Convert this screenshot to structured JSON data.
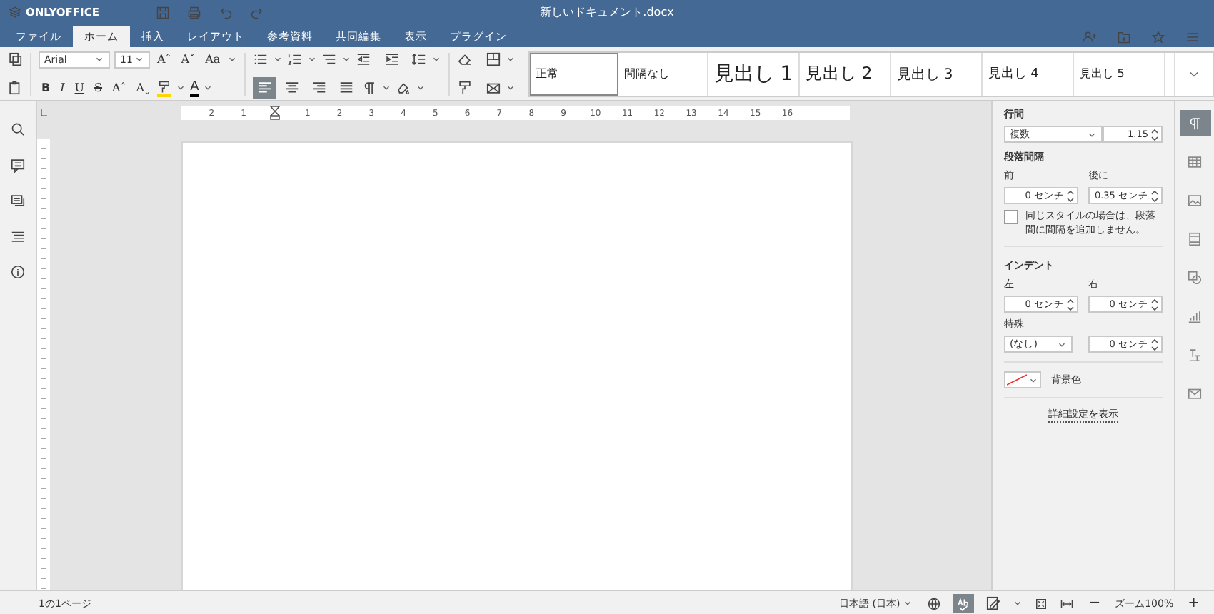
{
  "window": {
    "logo": "ONLYOFFICE",
    "title": "新しいドキュメント.docx"
  },
  "tabs": [
    {
      "label": "ファイル",
      "selected": false
    },
    {
      "label": "ホーム",
      "selected": true
    },
    {
      "label": "挿入",
      "selected": false
    },
    {
      "label": "レイアウト",
      "selected": false
    },
    {
      "label": "参考資料",
      "selected": false
    },
    {
      "label": "共同編集",
      "selected": false
    },
    {
      "label": "表示",
      "selected": false
    },
    {
      "label": "プラグイン",
      "selected": false
    }
  ],
  "toolbar": {
    "font": "Arial",
    "size": "11",
    "font_buttons": [
      "Aˆ",
      "Aˇ",
      "Aa"
    ],
    "format_buttons": [
      "B",
      "I",
      "U",
      "S",
      "Aˆ",
      "A˯"
    ],
    "font_color_glyph": "A",
    "align_buttons": [
      {
        "kind": "left",
        "selected": true
      },
      {
        "kind": "center",
        "selected": false
      },
      {
        "kind": "right",
        "selected": false
      },
      {
        "kind": "justify",
        "selected": false
      }
    ],
    "styles": [
      {
        "label": "正常",
        "selected": true
      },
      {
        "label": "間隔なし",
        "selected": false
      },
      {
        "label": "見出し 1",
        "selected": false
      },
      {
        "label": "見出し 2",
        "selected": false
      },
      {
        "label": "見出し 3",
        "selected": false
      },
      {
        "label": "見出し 4",
        "selected": false
      },
      {
        "label": "見出し 5",
        "selected": false
      }
    ]
  },
  "ruler": {
    "left_labels": [
      "2",
      "1"
    ],
    "right_labels": [
      "1",
      "2",
      "3",
      "4",
      "5",
      "6",
      "7",
      "8",
      "9",
      "10",
      "11",
      "12",
      "13",
      "14",
      "15",
      "16"
    ]
  },
  "panel": {
    "line_spacing_label": "行間",
    "line_spacing_mode": "複数",
    "line_spacing_value": "1.15",
    "paragraph_spacing_label": "段落間隔",
    "before_label": "前",
    "after_label": "後に",
    "before_value": "0 センチ",
    "after_value": "0.35 センチ",
    "no_space_checkbox": {
      "label": "同じスタイルの場合は、段落間に間隔を追加しません。",
      "checked": false
    },
    "indent_label": "インデント",
    "left_label": "左",
    "right_label": "右",
    "left_value": "0 センチ",
    "right_value": "0 センチ",
    "special_label": "特殊",
    "special_mode": "(なし)",
    "special_value": "0 センチ",
    "background_label": "背景色",
    "advanced_link": "詳細設定を表示"
  },
  "right_bar": [
    {
      "kind": "paragraph",
      "selected": true
    },
    {
      "kind": "table",
      "selected": false
    },
    {
      "kind": "image",
      "selected": false
    },
    {
      "kind": "header",
      "selected": false
    },
    {
      "kind": "shape",
      "selected": false
    },
    {
      "kind": "chart",
      "selected": false
    },
    {
      "kind": "textart",
      "selected": false
    },
    {
      "kind": "mail",
      "selected": false
    }
  ],
  "status_bar": {
    "page": "1の1ページ",
    "language": "日本語 (日本)",
    "spellcheck": true,
    "zoom": "ズーム100%",
    "zoom_out": "−",
    "zoom_in": "+"
  }
}
